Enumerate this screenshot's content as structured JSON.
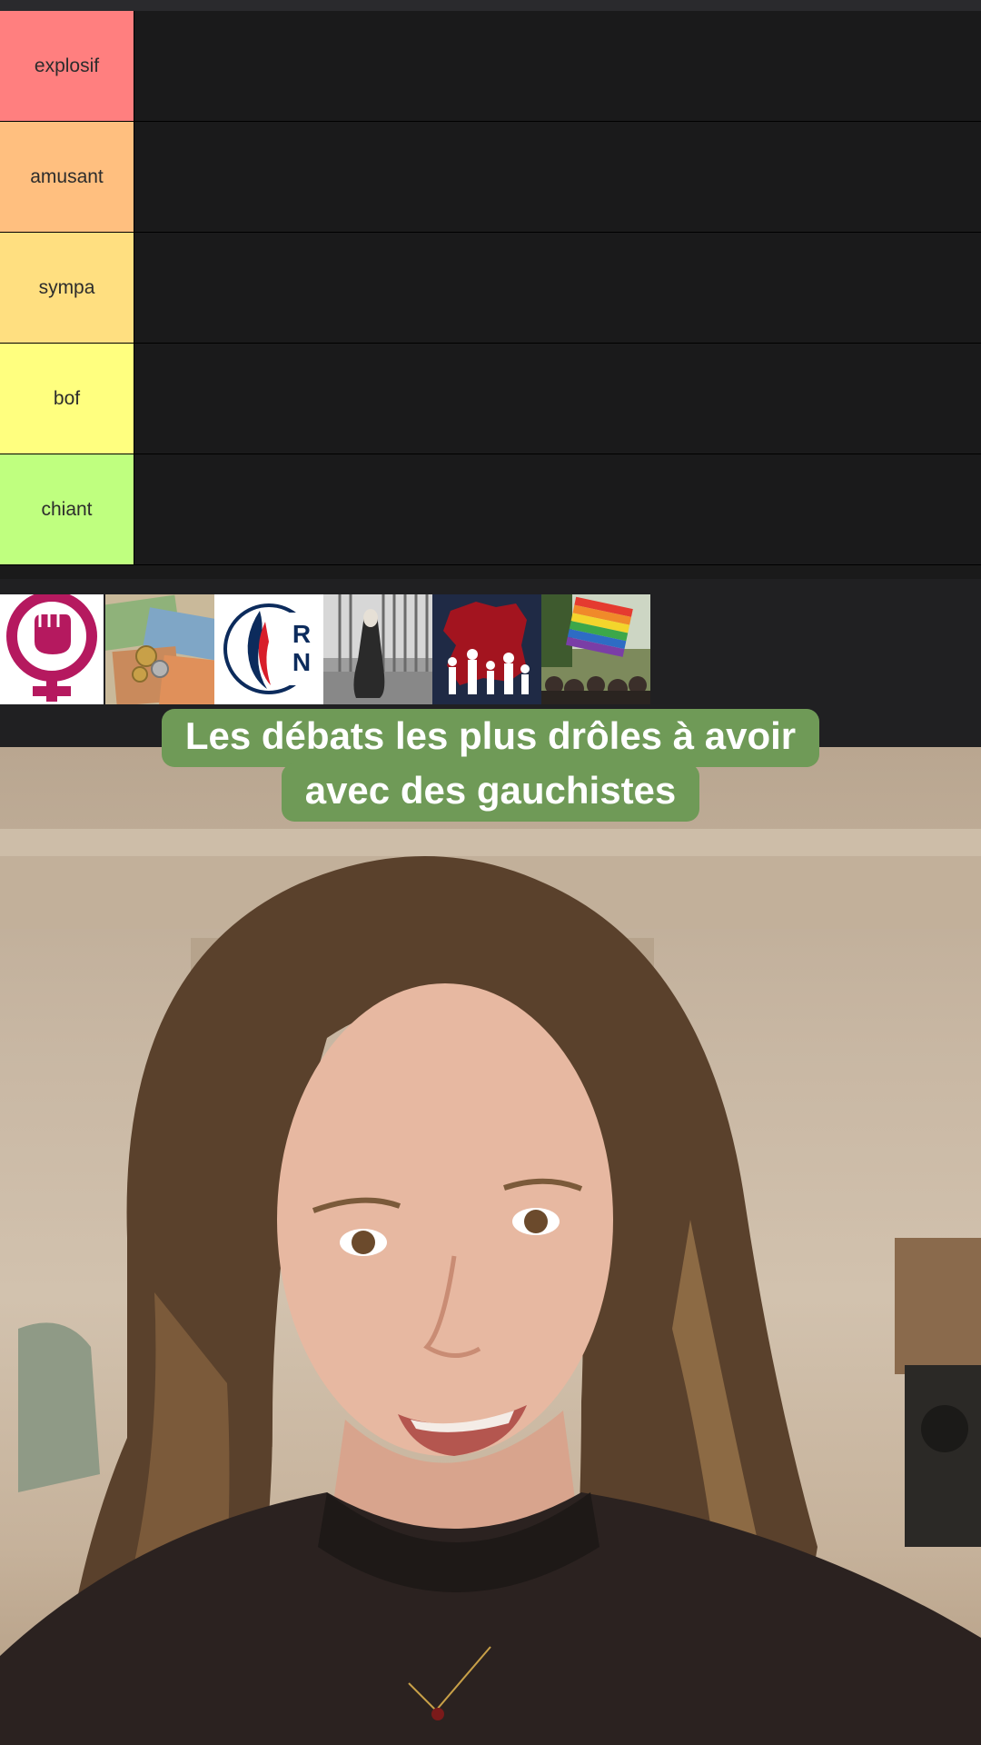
{
  "tiers": [
    {
      "label": "explosif",
      "color": "#ff7f7f"
    },
    {
      "label": "amusant",
      "color": "#ffbf7f"
    },
    {
      "label": "sympa",
      "color": "#ffdf80"
    },
    {
      "label": "bof",
      "color": "#ffff7f"
    },
    {
      "label": "chiant",
      "color": "#bfff7f"
    }
  ],
  "pool_items": [
    {
      "name": "feminism-symbol"
    },
    {
      "name": "euro-money"
    },
    {
      "name": "rn-logo",
      "text": "RN"
    },
    {
      "name": "veiled-woman-photo"
    },
    {
      "name": "immigration-map"
    },
    {
      "name": "pride-flag-crowd"
    }
  ],
  "caption": {
    "line1": "Les débats les plus drôles à avoir",
    "line2": "avec des gauchistes"
  },
  "colors": {
    "caption_bg": "#6f9a57",
    "feminism": "#b5195f",
    "rn_blue": "#0c2b5c"
  }
}
